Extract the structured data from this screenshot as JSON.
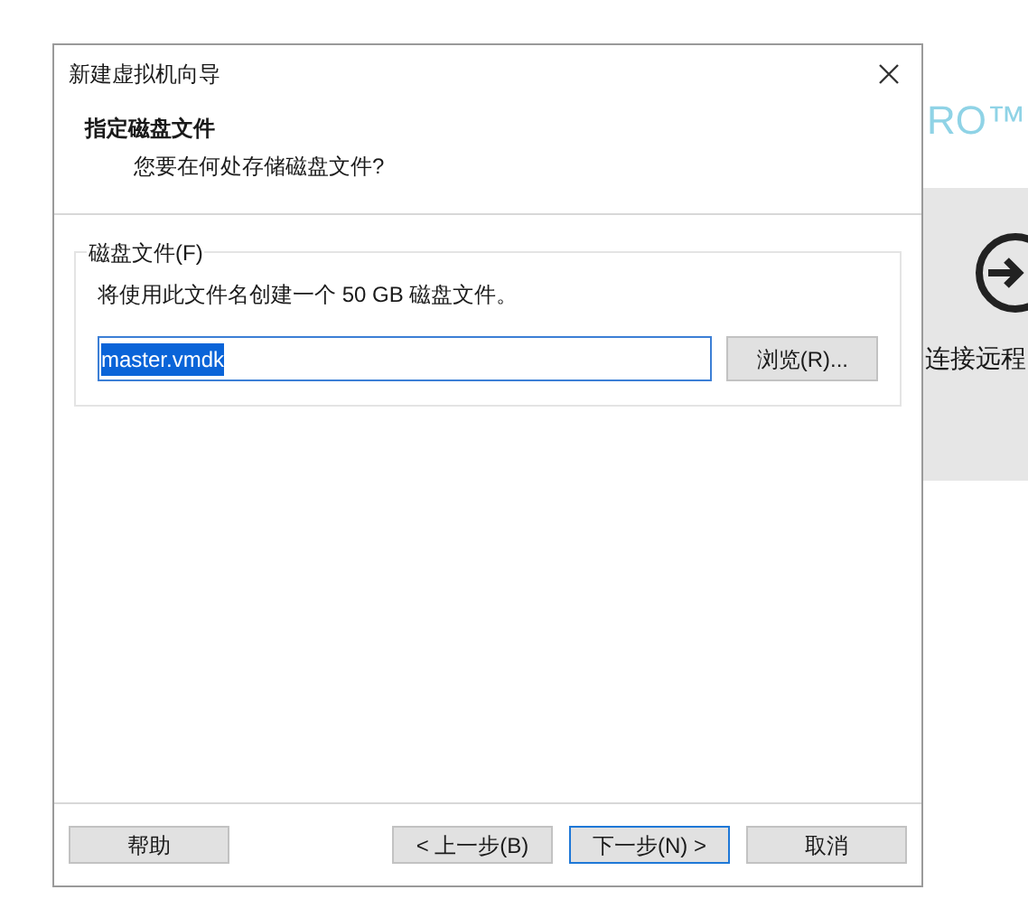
{
  "background_app": {
    "logo_fragment": "RO™",
    "action_label": "连接远程"
  },
  "window": {
    "title": "新建虚拟机向导"
  },
  "header": {
    "title": "指定磁盘文件",
    "subtitle": "您要在何处存储磁盘文件?"
  },
  "group": {
    "label": "磁盘文件(F)",
    "description": "将使用此文件名创建一个 50 GB 磁盘文件。",
    "file_field": {
      "value": "master.vmdk",
      "text_selected": true
    },
    "browse_button": "浏览(R)..."
  },
  "buttons": [
    {
      "label": "帮助",
      "default": false
    },
    {
      "label": "< 上一步(B)",
      "default": false
    },
    {
      "label": "下一步(N) >",
      "default": true
    },
    {
      "label": "取消",
      "default": false
    }
  ]
}
